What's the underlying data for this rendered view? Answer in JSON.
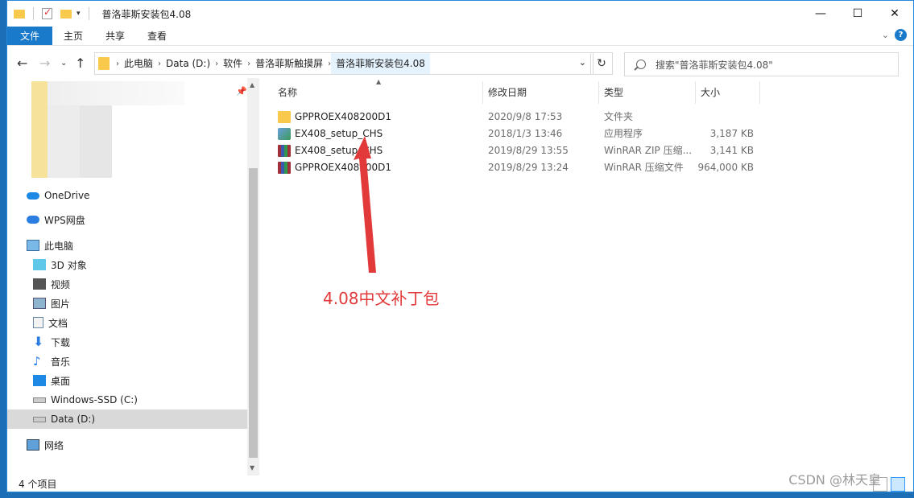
{
  "window": {
    "title": "普洛菲斯安装包4.08"
  },
  "ribbon": {
    "tabs": [
      "文件",
      "主页",
      "共享",
      "查看"
    ]
  },
  "address": {
    "crumbs": [
      "此电脑",
      "Data (D:)",
      "软件",
      "普洛菲斯触摸屏",
      "普洛菲斯安装包4.08"
    ],
    "search_placeholder": "搜索\"普洛菲斯安装包4.08\""
  },
  "sidebar": {
    "items": [
      {
        "label": "OneDrive",
        "icon": "onedrive-icon"
      },
      {
        "label": "WPS网盘",
        "icon": "wps-cloud-icon"
      },
      {
        "label": "此电脑",
        "icon": "computer-icon"
      },
      {
        "label": "3D 对象",
        "icon": "3d-objects-icon"
      },
      {
        "label": "视频",
        "icon": "video-icon"
      },
      {
        "label": "图片",
        "icon": "pictures-icon"
      },
      {
        "label": "文档",
        "icon": "documents-icon"
      },
      {
        "label": "下载",
        "icon": "downloads-icon"
      },
      {
        "label": "音乐",
        "icon": "music-icon"
      },
      {
        "label": "桌面",
        "icon": "desktop-icon"
      },
      {
        "label": "Windows-SSD (C:)",
        "icon": "drive-icon"
      },
      {
        "label": "Data (D:)",
        "icon": "drive-icon"
      },
      {
        "label": "网络",
        "icon": "network-icon"
      }
    ],
    "selected": "Data (D:)"
  },
  "columns": [
    "名称",
    "修改日期",
    "类型",
    "大小"
  ],
  "files": [
    {
      "name": "GPPROEX408200D1",
      "date": "2020/9/8 17:53",
      "type": "文件夹",
      "size": "",
      "icon": "folder-icon"
    },
    {
      "name": "EX408_setup_CHS",
      "date": "2018/1/3 13:46",
      "type": "应用程序",
      "size": "3,187 KB",
      "icon": "app-icon"
    },
    {
      "name": "EX408_setup_CHS",
      "date": "2019/8/29 13:55",
      "type": "WinRAR ZIP 压缩...",
      "size": "3,141 KB",
      "icon": "winrar-icon"
    },
    {
      "name": "GPPROEX408200D1",
      "date": "2019/8/29 13:24",
      "type": "WinRAR 压缩文件",
      "size": "964,000 KB",
      "icon": "winrar-icon"
    }
  ],
  "annotation": "4.08中文补丁包",
  "status": {
    "count": "4 个项目"
  },
  "watermark": "CSDN @林天皇",
  "colors": {
    "accent": "#1979ca",
    "annotation": "#e23a3a",
    "folder": "#f8c94a",
    "selected_row": "#d9d9d9"
  }
}
